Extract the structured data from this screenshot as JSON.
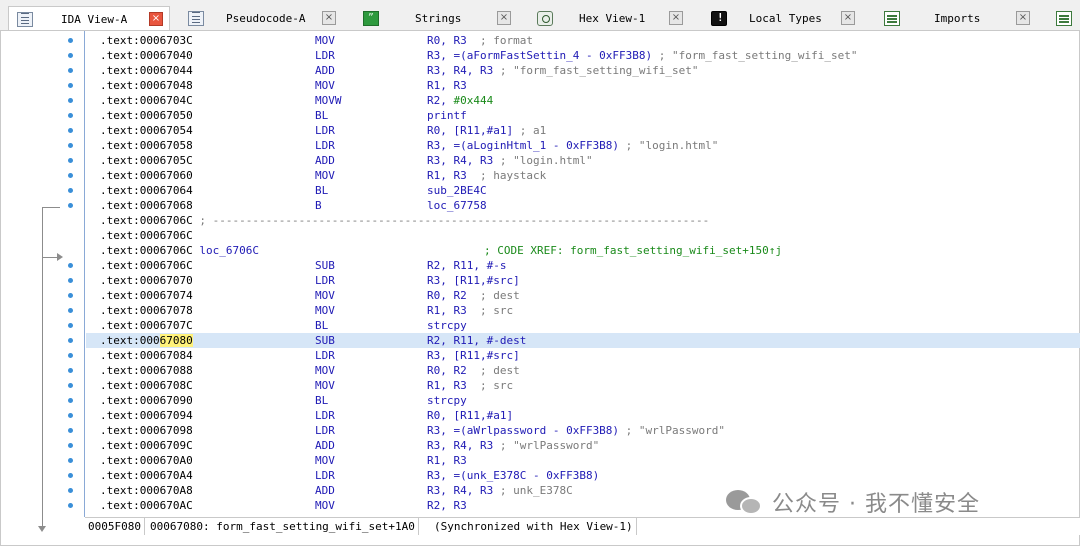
{
  "tabs": [
    {
      "label": "IDA View-A",
      "icon": "doc-icon",
      "active": true,
      "close": "×"
    },
    {
      "label": "Pseudocode-A",
      "icon": "doc-icon",
      "active": false,
      "close": "×"
    },
    {
      "label": "Strings",
      "icon": "strings-icon",
      "active": false,
      "close": "×"
    },
    {
      "label": "Hex View-1",
      "icon": "hex-icon",
      "active": false,
      "close": "×"
    },
    {
      "label": "Local Types",
      "icon": "types-icon",
      "active": false,
      "close": "×"
    },
    {
      "label": "Imports",
      "icon": "imports-icon",
      "active": false,
      "close": "×"
    }
  ],
  "code": [
    {
      "addr": ".text:0006703C",
      "mnem": "MOV",
      "ops": "R0, R3",
      "cmt": "  ; format"
    },
    {
      "addr": ".text:00067040",
      "mnem": "LDR",
      "ops": "R3, =(aFormFastSettin_4 - 0xFF3B8)",
      "cmt": " ; \"form_fast_setting_wifi_set\""
    },
    {
      "addr": ".text:00067044",
      "mnem": "ADD",
      "ops": "R3, R4, R3",
      "cmt": " ; \"form_fast_setting_wifi_set\""
    },
    {
      "addr": ".text:00067048",
      "mnem": "MOV",
      "ops": "R1, R3",
      "cmt": ""
    },
    {
      "addr": ".text:0006704C",
      "mnem": "MOVW",
      "ops": "R2, #0x444",
      "cmt": ""
    },
    {
      "addr": ".text:00067050",
      "mnem": "BL",
      "ops": "printf",
      "cmt": ""
    },
    {
      "addr": ".text:00067054",
      "mnem": "LDR",
      "ops": "R0, [R11,#a1]",
      "cmt": " ; a1"
    },
    {
      "addr": ".text:00067058",
      "mnem": "LDR",
      "ops": "R3, =(aLoginHtml_1 - 0xFF3B8)",
      "cmt": " ; \"login.html\""
    },
    {
      "addr": ".text:0006705C",
      "mnem": "ADD",
      "ops": "R3, R4, R3",
      "cmt": " ; \"login.html\""
    },
    {
      "addr": ".text:00067060",
      "mnem": "MOV",
      "ops": "R1, R3",
      "cmt": "  ; haystack"
    },
    {
      "addr": ".text:00067064",
      "mnem": "BL",
      "ops": "sub_2BE4C",
      "cmt": ""
    },
    {
      "addr": ".text:00067068",
      "mnem": "B",
      "ops": "loc_67758",
      "cmt": ""
    },
    {
      "addr": ".text:0006706C",
      "sep": " ; ---------------------------------------------------------------------------"
    },
    {
      "addr": ".text:0006706C",
      "mnem": "",
      "ops": "",
      "cmt": ""
    },
    {
      "addr": ".text:0006706C",
      "label": "loc_6706C",
      "xref": "; CODE XREF: form_fast_setting_wifi_set+150↑j"
    },
    {
      "addr": ".text:0006706C",
      "mnem": "SUB",
      "ops": "R2, R11, #-s",
      "cmt": ""
    },
    {
      "addr": ".text:00067070",
      "mnem": "LDR",
      "ops": "R3, [R11,#src]",
      "cmt": ""
    },
    {
      "addr": ".text:00067074",
      "mnem": "MOV",
      "ops": "R0, R2",
      "cmt": "  ; dest"
    },
    {
      "addr": ".text:00067078",
      "mnem": "MOV",
      "ops": "R1, R3",
      "cmt": "  ; src"
    },
    {
      "addr": ".text:0006707C",
      "mnem": "BL",
      "ops": "strcpy",
      "cmt": ""
    },
    {
      "addr": ".text:00067080",
      "mnem": "SUB",
      "ops": "R2, R11, #-dest",
      "cmt": "",
      "highlight": true
    },
    {
      "addr": ".text:00067084",
      "mnem": "LDR",
      "ops": "R3, [R11,#src]",
      "cmt": ""
    },
    {
      "addr": ".text:00067088",
      "mnem": "MOV",
      "ops": "R0, R2",
      "cmt": "  ; dest"
    },
    {
      "addr": ".text:0006708C",
      "mnem": "MOV",
      "ops": "R1, R3",
      "cmt": "  ; src"
    },
    {
      "addr": ".text:00067090",
      "mnem": "BL",
      "ops": "strcpy",
      "cmt": ""
    },
    {
      "addr": ".text:00067094",
      "mnem": "LDR",
      "ops": "R0, [R11,#a1]",
      "cmt": ""
    },
    {
      "addr": ".text:00067098",
      "mnem": "LDR",
      "ops": "R3, =(aWrlpassword - 0xFF3B8)",
      "cmt": " ; \"wrlPassword\""
    },
    {
      "addr": ".text:0006709C",
      "mnem": "ADD",
      "ops": "R3, R4, R3",
      "cmt": " ; \"wrlPassword\""
    },
    {
      "addr": ".text:000670A0",
      "mnem": "MOV",
      "ops": "R1, R3",
      "cmt": ""
    },
    {
      "addr": ".text:000670A4",
      "mnem": "LDR",
      "ops": "R3, =(unk_E378C - 0xFF3B8)",
      "cmt": ""
    },
    {
      "addr": ".text:000670A8",
      "mnem": "ADD",
      "ops": "R3, R4, R3",
      "cmt": " ; unk_E378C"
    },
    {
      "addr": ".text:000670AC",
      "mnem": "MOV",
      "ops": "R2, R3",
      "cmt": ""
    }
  ],
  "highlight_addr": {
    "prefix": ".text:000",
    "hi": "67080"
  },
  "status": {
    "offset": "0005F080",
    "location": "00067080: form_fast_setting_wifi_set+1A0",
    "sync": "(Synchronized with Hex View-1)"
  },
  "watermark": {
    "text": "公众号 · 我不懂安全",
    "icon": "wechat-icon"
  },
  "colors": {
    "code": "#1f1ab5",
    "comment": "#7a7a7a",
    "number": "#1a8a1a",
    "highlight_row": "#d6e6f7",
    "highlight_text": "#fff27a",
    "gutter_dot": "#3a8fd8"
  }
}
